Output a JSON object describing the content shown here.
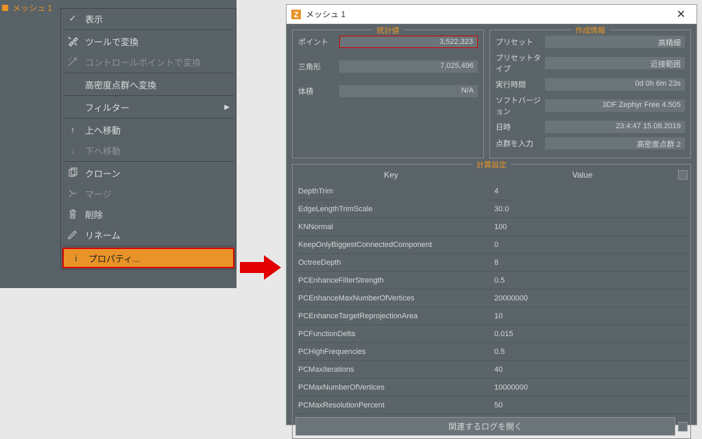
{
  "leftPanel": {
    "meshLabel": "メッシュ 1"
  },
  "menu": {
    "display": "表示",
    "convertTool": "ツールで変換",
    "convertCP": "コントロールポイントで変換",
    "convertDense": "高密度点群へ変換",
    "filter": "フィルター",
    "moveUp": "上へ移動",
    "moveDown": "下へ移動",
    "clone": "クローン",
    "merge": "マージ",
    "delete": "削除",
    "rename": "リネーム",
    "properties": "プロパティ..."
  },
  "dialog": {
    "title": "メッシュ 1",
    "stats": {
      "legend": "統計値",
      "points": {
        "label": "ポイント",
        "value": "3,522,323"
      },
      "triangles": {
        "label": "三角形",
        "value": "7,025,496"
      },
      "volume": {
        "label": "体積",
        "value": "N/A"
      }
    },
    "info": {
      "legend": "作成情報",
      "preset": {
        "label": "プリセット",
        "value": "高精細"
      },
      "presetType": {
        "label": "プリセットタイプ",
        "value": "近接範囲"
      },
      "runtime": {
        "label": "実行時間",
        "value": "0d 0h 6m 23s"
      },
      "softVer": {
        "label": "ソフトバージョン",
        "value": "3DF Zephyr Free 4.505"
      },
      "datetime": {
        "label": "日時",
        "value": "23:4:47 15.08.2019"
      },
      "inputCloud": {
        "label": "点群を入力",
        "value": "高密度点群 2"
      }
    },
    "calc": {
      "legend": "計算設定",
      "headerKey": "Key",
      "headerValue": "Value",
      "rows": [
        {
          "k": "DepthTrim",
          "v": "4"
        },
        {
          "k": "EdgeLengthTrimScale",
          "v": "30.0"
        },
        {
          "k": "KNNormal",
          "v": "100"
        },
        {
          "k": "KeepOnlyBiggestConnectedComponent",
          "v": "0"
        },
        {
          "k": "OctreeDepth",
          "v": "8"
        },
        {
          "k": "PCEnhanceFilterStrength",
          "v": "0.5"
        },
        {
          "k": "PCEnhanceMaxNumberOfVertices",
          "v": "20000000"
        },
        {
          "k": "PCEnhanceTargetReprojectionArea",
          "v": "10"
        },
        {
          "k": "PCFunctionDelta",
          "v": "0.015"
        },
        {
          "k": "PCHighFrequencies",
          "v": "0.5"
        },
        {
          "k": "PCMaxIterations",
          "v": "40"
        },
        {
          "k": "PCMaxNumberOfVertices",
          "v": "10000000"
        },
        {
          "k": "PCMaxResolutionPercent",
          "v": "50"
        }
      ],
      "openLogs": "関連するログを開く"
    }
  }
}
